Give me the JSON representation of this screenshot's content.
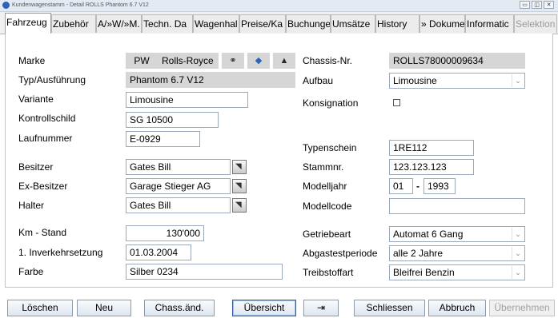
{
  "window": {
    "title": "Kundenwagenstamm - Detail ROLLS Phantom 6.7 V12",
    "controls": {
      "minimize": "▭",
      "restore": "◫",
      "close": "✕"
    }
  },
  "tabs": [
    {
      "label": "Fahrzeug"
    },
    {
      "label": "Zubehör"
    },
    {
      "label": "A/»W/»M."
    },
    {
      "label": "Techn. Da"
    },
    {
      "label": "Wagenhal"
    },
    {
      "label": "Preise/Ka"
    },
    {
      "label": "Buchunge"
    },
    {
      "label": "Umsätze"
    },
    {
      "label": "History"
    },
    {
      "label": "» Dokume"
    },
    {
      "label": "Informatic"
    },
    {
      "label": "Selektion"
    }
  ],
  "left": {
    "marke": {
      "label": "Marke",
      "code": "PW",
      "value": "Rolls-Royce"
    },
    "typ": {
      "label": "Typ/Ausführung",
      "value": "Phantom 6.7 V12"
    },
    "variante": {
      "label": "Variante",
      "value": "Limousine"
    },
    "kontrollschild": {
      "label": "Kontrollschild",
      "value": "SG 10500"
    },
    "laufnummer": {
      "label": "Laufnummer",
      "value": "E-0929"
    },
    "besitzer": {
      "label": "Besitzer",
      "value": "Gates Bill"
    },
    "ex_besitzer": {
      "label": "Ex-Besitzer",
      "value": "Garage Stieger AG"
    },
    "halter": {
      "label": "Halter",
      "value": "Gates Bill"
    },
    "km_stand": {
      "label": "Km - Stand",
      "value": "130'000"
    },
    "inverkehrsetzung": {
      "label": "1. Inverkehrsetzung",
      "value": "01.03.2004"
    },
    "farbe": {
      "label": "Farbe",
      "value": "Silber 0234"
    }
  },
  "right": {
    "chassis": {
      "label": "Chassis-Nr.",
      "value": "ROLLS78000009634"
    },
    "aufbau": {
      "label": "Aufbau",
      "value": "Limousine"
    },
    "konsignation": {
      "label": "Konsignation",
      "checked": false
    },
    "typenschein": {
      "label": "Typenschein",
      "value": "1RE112"
    },
    "stammnr": {
      "label": "Stammnr.",
      "value": "123.123.123"
    },
    "modelljahr": {
      "label": "Modelljahr",
      "month": "01",
      "separator": "-",
      "year": "1993"
    },
    "modellcode": {
      "label": "Modellcode",
      "value": ""
    },
    "getriebeart": {
      "label": "Getriebeart",
      "value": "Automat 6 Gang"
    },
    "abgastestperiode": {
      "label": "Abgastestperiode",
      "value": "alle 2 Jahre"
    },
    "treibstoffart": {
      "label": "Treibstoffart",
      "value": "Bleifrei Benzin"
    }
  },
  "icons": {
    "binoculars": "⚭",
    "diamond": "◆",
    "car": "▲",
    "combo_arrow": "⌄",
    "picker_arrow": "◥"
  },
  "buttons": {
    "loeschen": "Löschen",
    "neu": "Neu",
    "chass_aend": "Chass.änd.",
    "uebersicht": "Übersicht",
    "pin": "⇥",
    "schliessen": "Schliessen",
    "abbruch": "Abbruch",
    "uebernehmen": "Übernehmen"
  }
}
